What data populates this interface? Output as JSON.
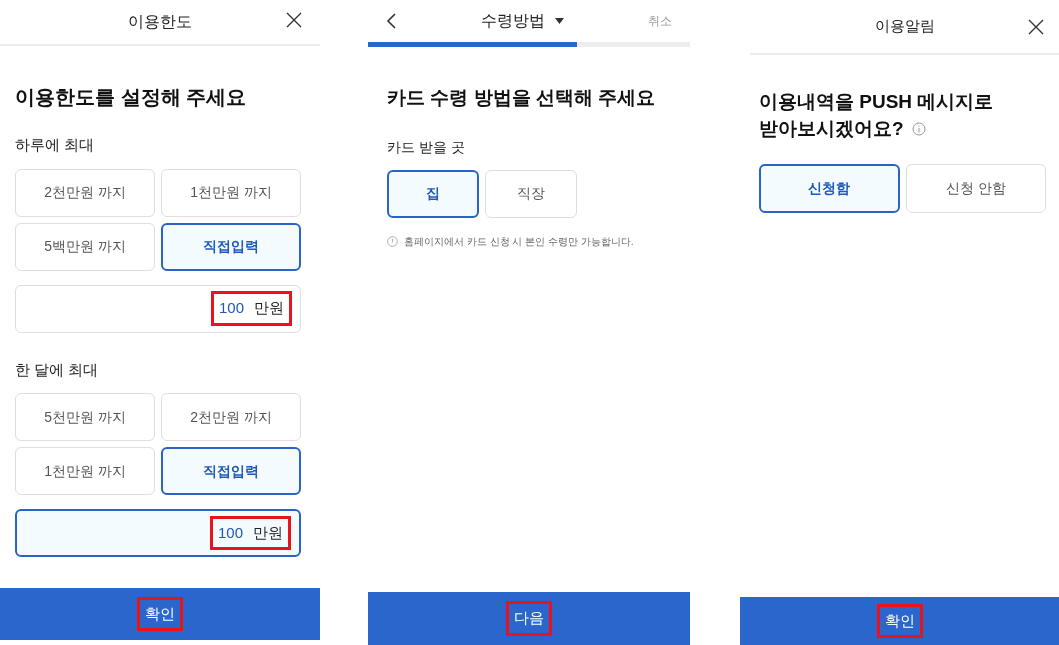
{
  "screens": [
    {
      "kind": "limit",
      "header": {
        "title": "이용한도"
      },
      "heading": "이용한도를 설정해 주세요",
      "groups": [
        {
          "label": "하루에 최대",
          "options": [
            {
              "label": "2천만원 까지",
              "selected": false
            },
            {
              "label": "1천만원 까지",
              "selected": false
            },
            {
              "label": "5백만원 까지",
              "selected": false
            },
            {
              "label": "직접입력",
              "selected": true
            }
          ],
          "amount": {
            "value": "100",
            "unit": "만원",
            "focused": false,
            "highlighted": true
          }
        },
        {
          "label": "한 달에 최대",
          "options": [
            {
              "label": "5천만원 까지",
              "selected": false
            },
            {
              "label": "2천만원 까지",
              "selected": false
            },
            {
              "label": "1천만원 까지",
              "selected": false
            },
            {
              "label": "직접입력",
              "selected": true
            }
          ],
          "amount": {
            "value": "100",
            "unit": "만원",
            "focused": true,
            "highlighted": true
          }
        }
      ],
      "primary_button": {
        "label": "확인",
        "highlighted": true
      }
    },
    {
      "kind": "delivery",
      "header": {
        "title": "수령방법",
        "action": "취소"
      },
      "progress": {
        "level": 0.65
      },
      "heading": "카드 수령 방법을 선택해 주세요",
      "label": "카드 받을 곳",
      "options": [
        {
          "label": "집",
          "selected": true
        },
        {
          "label": "직장",
          "selected": false
        }
      ],
      "note": "홈페이지에서 카드 신청 시 본인 수령만 가능합니다.",
      "primary_button": {
        "label": "다음",
        "highlighted": true
      }
    },
    {
      "kind": "alert",
      "header": {
        "title": "이용알림"
      },
      "heading_lines": [
        "이용내역을 PUSH 메시지로",
        "받아보시겠어요?"
      ],
      "options": [
        {
          "label": "신청함",
          "selected": true
        },
        {
          "label": "신청 안함",
          "selected": false
        }
      ],
      "primary_button": {
        "label": "확인",
        "highlighted": true
      }
    }
  ]
}
